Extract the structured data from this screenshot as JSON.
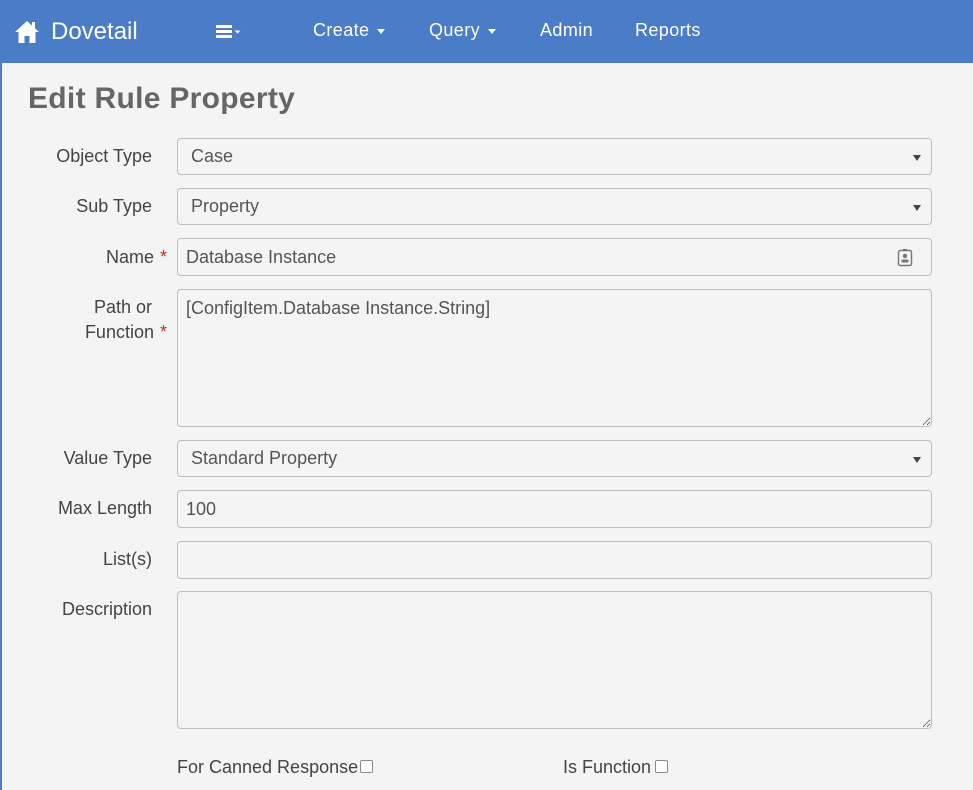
{
  "navbar": {
    "brand": "Dovetail",
    "items": [
      {
        "label": "Create"
      },
      {
        "label": "Query"
      },
      {
        "label": "Admin"
      },
      {
        "label": "Reports"
      }
    ],
    "background_color": "#4a7cc8"
  },
  "page": {
    "title": "Edit Rule Property"
  },
  "form": {
    "object_type": {
      "label": "Object Type",
      "value": "Case"
    },
    "sub_type": {
      "label": "Sub Type",
      "value": "Property"
    },
    "name": {
      "label": "Name",
      "required_mark": "*",
      "value": "Database Instance"
    },
    "path_or_function": {
      "label_line1": "Path or",
      "label_line2": "Function",
      "required_mark": "*",
      "value": "[ConfigItem.Database Instance.String]"
    },
    "value_type": {
      "label": "Value Type",
      "value": "Standard Property"
    },
    "max_length": {
      "label": "Max Length",
      "value": "100"
    },
    "lists": {
      "label": "List(s)",
      "value": ""
    },
    "description": {
      "label": "Description",
      "value": ""
    },
    "for_canned_response": {
      "label": "For Canned Response",
      "checked": false
    },
    "is_function": {
      "label": "Is Function",
      "checked": false
    }
  },
  "colors": {
    "required": "#b9312b",
    "title": "#666666"
  }
}
